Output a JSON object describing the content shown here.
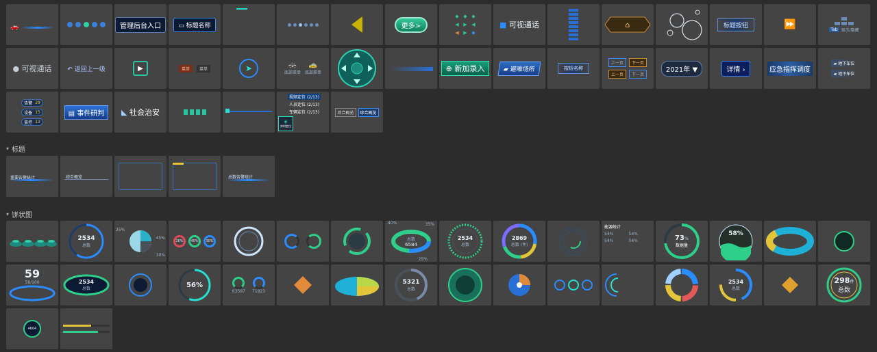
{
  "colors": {
    "background": "#2c2c2c",
    "tile": "#444444",
    "accent_blue": "#2a8cff",
    "accent_cyan": "#28e0d0",
    "accent_green": "#2ecf8a",
    "accent_yellow": "#e3c53a"
  },
  "row1": {
    "admin_entry": "管理后台入口",
    "title_name": "标题名称",
    "more": "更多>",
    "video_call": "可视通话",
    "title_button": "标题按钮",
    "show_hide": "显示/隐藏",
    "tab_key": "Tab"
  },
  "row2": {
    "video_call": "可视通话",
    "back": "返回上一级",
    "tabs": [
      "菜单",
      "菜单"
    ],
    "bottom_menu_1": "底部菜单",
    "bottom_menu_2": "底部菜单",
    "add_entry": "新加录入",
    "shelter": "避难场所",
    "button_name": "按钮名称",
    "prev": "上一页",
    "next": "下一页",
    "year_select": "2021年",
    "detail": "详情",
    "emergency": "应急指挥调度",
    "parking_1": "地下车位",
    "parking_2": "地下车位"
  },
  "row3": {
    "stat_items": [
      {
        "label": "告警",
        "value": "29"
      },
      {
        "label": "设备",
        "value": "15"
      },
      {
        "label": "监控",
        "value": "13"
      }
    ],
    "event_judge": "事件研判",
    "public_security": "社会治安",
    "location_items": [
      {
        "label": "视频定位",
        "count": "(2/13)"
      },
      {
        "label": "人员定位",
        "count": "(2/13)"
      },
      {
        "label": "车辆定位",
        "count": "(2/13)"
      }
    ],
    "realtime_location": "实时定位",
    "overview_1": "综合概览",
    "overview_2": "综合概览"
  },
  "sections": {
    "titles": "标题",
    "pies": "饼状图"
  },
  "title_tiles": [
    "重要告警统计",
    "综合概览",
    "",
    "",
    "总数告警统计"
  ],
  "pie_row1": {
    "donut_total": {
      "value": "2534",
      "label": "总数"
    },
    "pct_labels": [
      "25%",
      "45%",
      "30%"
    ],
    "ring_pcts": [
      "20%",
      "40%",
      "30%"
    ],
    "pct_40": "40%",
    "pct_35": "35%",
    "pct_25": "25%",
    "green_ring_value": "6584",
    "green_ring_label": "总数",
    "dash_total": {
      "value": "2534",
      "label": "总数"
    },
    "count_total": {
      "value": "2869",
      "label": "总数 (件)"
    },
    "stat_panel_title": "能源统计",
    "stat_panel_pct": "54%",
    "data_gauge": {
      "value": "73",
      "unit": "%",
      "label": "数据量"
    },
    "water_pct": "58%"
  },
  "pie_row2": {
    "big_number": "59",
    "big_number_sub": "59/100",
    "flat_total": {
      "value": "2534",
      "label": "总数"
    },
    "pct_56": "56%",
    "dual_values": [
      "63587",
      "71823"
    ],
    "ring_value": "5321",
    "ring_label": "总数",
    "donut_total": {
      "value": "2534",
      "label": "总数"
    },
    "big_total": {
      "value": "298",
      "unit": "件",
      "label": "总数"
    },
    "small_count": "4604"
  }
}
